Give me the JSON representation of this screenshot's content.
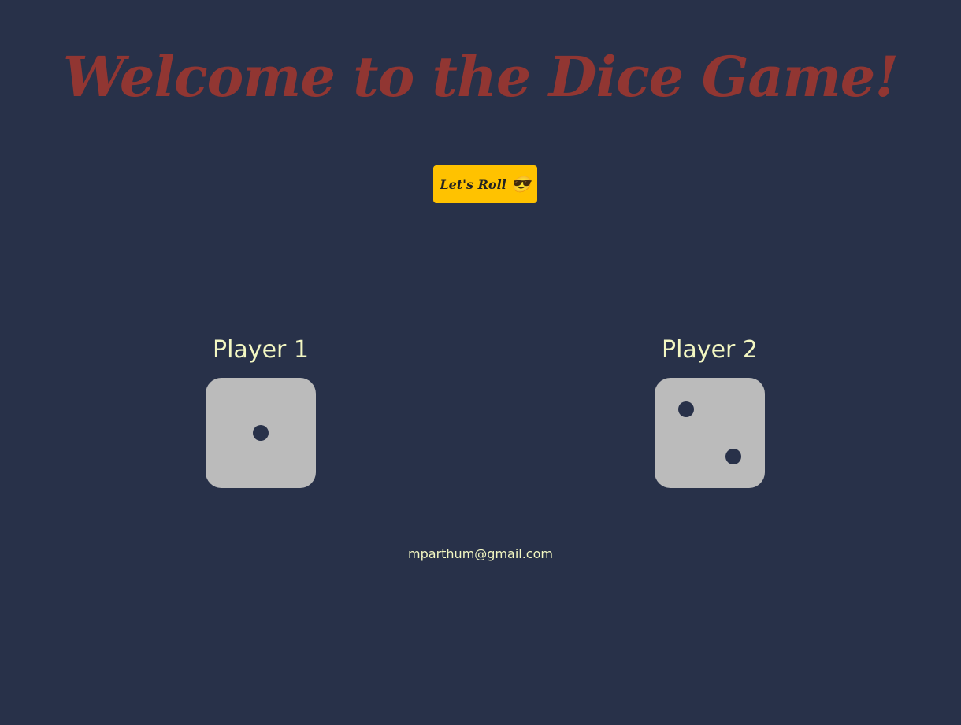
{
  "page": {
    "title": "Welcome to the Dice Game!",
    "roll_button": {
      "label": "Let's Roll",
      "emoji": "😎"
    },
    "footer_email": "mparthum@gmail.com"
  },
  "players": [
    {
      "name": "Player 1",
      "die_value": 1
    },
    {
      "name": "Player 2",
      "die_value": 2
    }
  ],
  "colors": {
    "background": "#283149",
    "title": "#913632",
    "button": "#FFC200",
    "button_text": "#222222",
    "player_text": "#F3F7C2",
    "die_face": "#BBBBBB",
    "pip": "#283149"
  }
}
